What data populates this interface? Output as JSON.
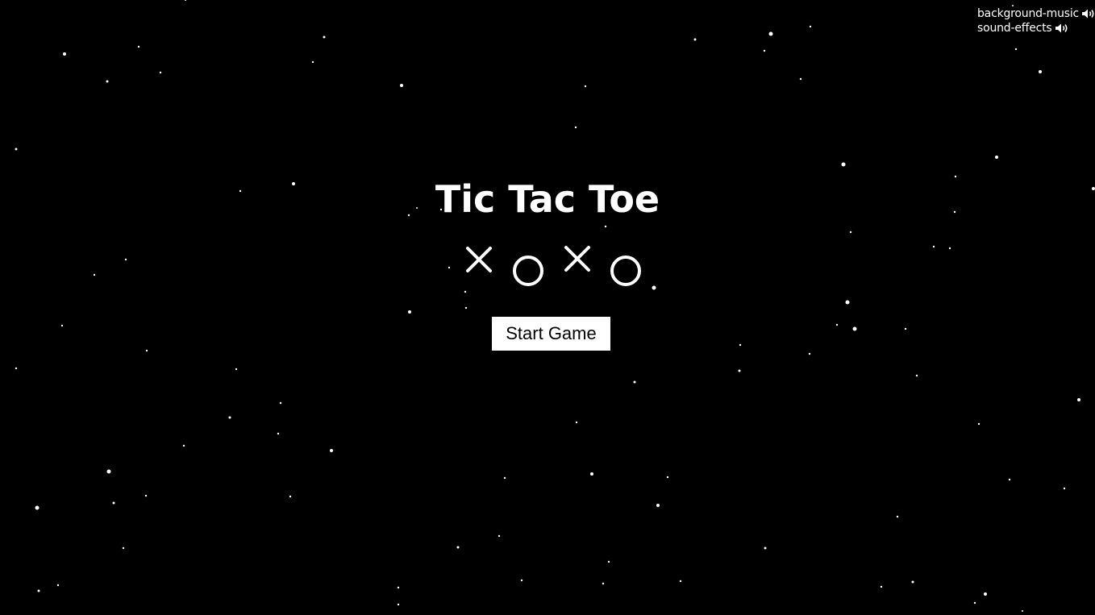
{
  "game": {
    "title": "Tic Tac Toe",
    "start_button_label": "Start Game",
    "marks": [
      "X",
      "O",
      "X",
      "O"
    ]
  },
  "audio": {
    "background_music_label": "background-music",
    "sound_effects_label": "sound-effects",
    "background_music_icon": "speaker-icon",
    "sound_effects_icon": "speaker-icon"
  },
  "colors": {
    "background": "#000000",
    "foreground": "#ffffff",
    "button_background": "#ffffff",
    "button_text": "#000000"
  }
}
